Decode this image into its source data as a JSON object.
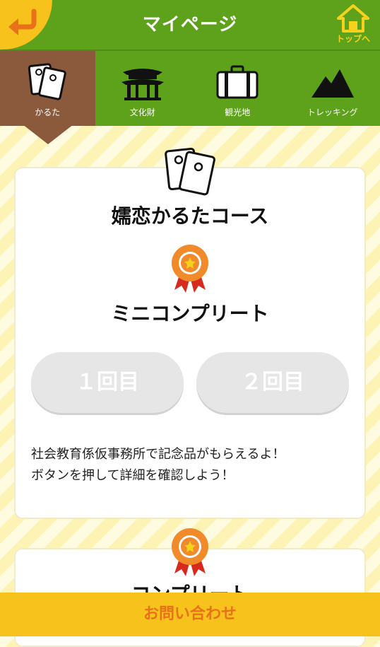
{
  "header": {
    "title": "マイページ",
    "home_label": "トップへ"
  },
  "tabs": [
    {
      "label": "かるた",
      "icon": "cards-icon",
      "active": true
    },
    {
      "label": "文化財",
      "icon": "shrine-icon",
      "active": false
    },
    {
      "label": "観光地",
      "icon": "suitcase-icon",
      "active": false
    },
    {
      "label": "トレッキング",
      "icon": "mountain-icon",
      "active": false
    }
  ],
  "course": {
    "title": "嬬恋かるたコース",
    "badge_title": "ミニコンプリート",
    "buttons": [
      "１回目",
      "２回目"
    ],
    "description_line1": "社会教育係仮事務所で記念品がもらえるよ！",
    "description_line2": "ボタンを押して詳細を確認しよう！"
  },
  "course2": {
    "badge_title": "コンプリート"
  },
  "footer": {
    "label": "お問い合わせ"
  },
  "colors": {
    "header_green": "#5ea11b",
    "accent_yellow": "#f7c21c",
    "active_tab_brown": "#8b5a3c",
    "footer_text_orange": "#e8711a"
  }
}
